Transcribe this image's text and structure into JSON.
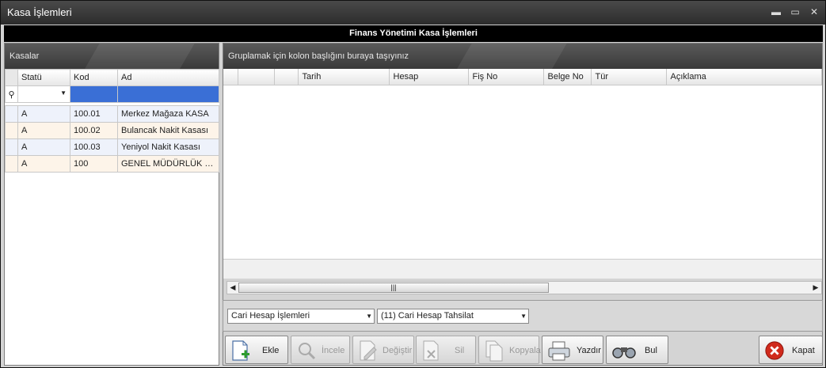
{
  "window": {
    "title": "Kasa İşlemleri",
    "min": "▬",
    "max": "▭",
    "close": "✕"
  },
  "header": {
    "title": "Finans Yönetimi Kasa İşlemleri"
  },
  "left": {
    "panel_title": "Kasalar",
    "columns": [
      "Statü",
      "Kod",
      "Ad"
    ],
    "rows": [
      {
        "status": "A",
        "code": "100.01",
        "name": "Merkez Mağaza KASA"
      },
      {
        "status": "A",
        "code": "100.02",
        "name": "Bulancak Nakit Kasası"
      },
      {
        "status": "A",
        "code": "100.03",
        "name": "Yeniyol Nakit Kasası"
      },
      {
        "status": "A",
        "code": "100",
        "name": "GENEL MÜDÜRLÜK NAKİT KASASI"
      }
    ]
  },
  "right": {
    "group_hint": "Gruplamak için kolon başlığını buraya taşıyınız",
    "columns": [
      "Tarih",
      "Hesap",
      "Fiş No",
      "Belge No",
      "Tür",
      "Açıklama"
    ]
  },
  "combos": {
    "type": "Cari Hesap İşlemleri",
    "subtype": "(11) Cari Hesap Tahsilat"
  },
  "buttons": {
    "add": "Ekle",
    "inspect": "İncele",
    "edit": "Değiştir",
    "delete": "Sil",
    "copy": "Kopyala",
    "print": "Yazdır",
    "find": "Bul",
    "close": "Kapat"
  },
  "colors": {
    "add": "#2e9c2e",
    "close": "#d02a1c"
  }
}
